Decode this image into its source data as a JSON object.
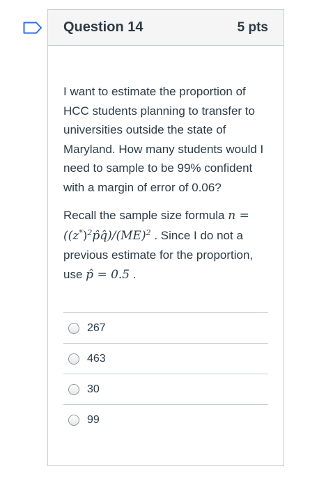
{
  "question": {
    "title": "Question 14",
    "points": "5 pts",
    "paragraph1": "I want to estimate the proportion of HCC students planning to transfer to universities outside the state of Maryland.   How many students would I need to sample to be 99% confident with a margin of error of 0.06?",
    "recall_text": "Recall the sample size formula",
    "formula_part_a": "n = ((z",
    "formula_sup_star": "*",
    "formula_part_b": ")",
    "formula_sup_2a": "2",
    "formula_part_c": "p̂q̂)/(ME)",
    "formula_sup_2b": "2",
    "since_text": ". Since I do not a previous estimate for the proportion, use",
    "phat_text": "p̂ = 0.5",
    "end_text": "."
  },
  "answers": [
    {
      "label": "267"
    },
    {
      "label": "463"
    },
    {
      "label": "30"
    },
    {
      "label": "99"
    }
  ],
  "colors": {
    "border": "#c7cdd1",
    "header_bg": "#f5f5f5",
    "text": "#2d3b45",
    "flag_accent": "#2d6ef6"
  },
  "icons": {
    "flag": "question-flag-icon"
  }
}
